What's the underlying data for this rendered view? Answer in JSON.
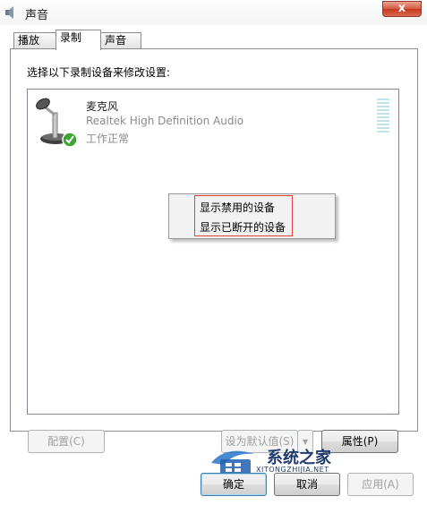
{
  "window": {
    "title": "声音",
    "close_label": "x"
  },
  "tabs": [
    {
      "label": "播放"
    },
    {
      "label": "录制"
    },
    {
      "label": "声音"
    }
  ],
  "instruction": "选择以下录制设备来修改设置:",
  "device": {
    "name": "麦克风",
    "description": "Realtek High Definition Audio",
    "status": "工作正常",
    "icon": "microphone-icon",
    "status_icon": "green-checkmark-icon"
  },
  "context_menu": {
    "items": [
      "显示禁用的设备",
      "显示已断开的设备"
    ]
  },
  "buttons": {
    "configure": "配置(C)",
    "set_default": "设为默认值(S)",
    "properties": "属性(P)",
    "ok": "确定",
    "cancel": "取消",
    "apply": "应用(A)"
  },
  "watermark": {
    "text": "系统之家",
    "sub": "XITONGZHIJIA.NET"
  },
  "colors": {
    "accent": "#3c7fb1",
    "highlight_border": "#e0413a",
    "close": "#c4381e"
  }
}
